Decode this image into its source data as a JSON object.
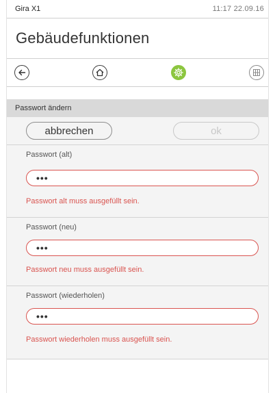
{
  "status_bar": {
    "app_name": "Gira X1",
    "time_date": "11:17  22.09.16"
  },
  "page": {
    "title": "Gebäudefunktionen"
  },
  "nav": {
    "icons": [
      "back-arrow-icon",
      "home-icon",
      "settings-gear-icon",
      "grid-icon"
    ],
    "active_color": "#8cc63f"
  },
  "form": {
    "section_title": "Passwort ändern",
    "cancel_label": "abbrechen",
    "ok_label": "ok",
    "fields": [
      {
        "label": "Passwort (alt)",
        "value": "•••",
        "error": "Passwort alt muss ausgefüllt sein."
      },
      {
        "label": "Passwort (neu)",
        "value": "•••",
        "error": "Passwort neu muss ausgefüllt sein."
      },
      {
        "label": "Passwort (wiederholen)",
        "value": "•••",
        "error": "Passwort wiederholen muss ausgefüllt sein."
      }
    ]
  },
  "colors": {
    "error": "#d9534f",
    "header_bg": "#d9d9d9",
    "content_bg": "#f4f4f4"
  }
}
